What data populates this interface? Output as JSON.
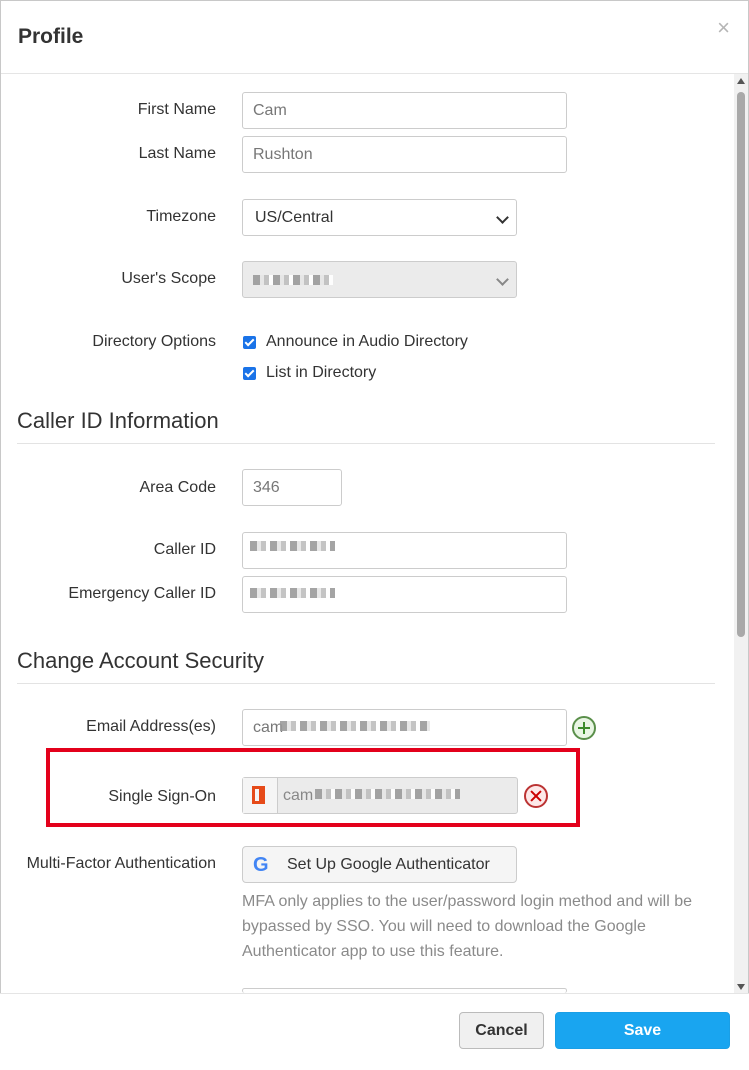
{
  "modal": {
    "title": "Profile",
    "close_label": "×"
  },
  "form": {
    "first_name": {
      "label": "First Name",
      "value": "Cam"
    },
    "last_name": {
      "label": "Last Name",
      "value": "Rushton"
    },
    "timezone": {
      "label": "Timezone",
      "value": "US/Central"
    },
    "scope": {
      "label": "User's Scope",
      "value": ""
    },
    "directory": {
      "label": "Directory Options",
      "options": [
        {
          "label": "Announce in Audio Directory",
          "checked": true
        },
        {
          "label": "List in Directory",
          "checked": true
        }
      ]
    }
  },
  "caller_id_section": {
    "title": "Caller ID Information",
    "area_code": {
      "label": "Area Code",
      "value": "346"
    },
    "caller_id": {
      "label": "Caller ID",
      "value": ""
    },
    "emergency_caller_id": {
      "label": "Emergency Caller ID",
      "value": ""
    }
  },
  "security_section": {
    "title": "Change Account Security",
    "email": {
      "label": "Email Address(es)",
      "value": "cam"
    },
    "sso": {
      "label": "Single Sign-On",
      "value": "cam",
      "provider_icon": "office-icon"
    },
    "mfa": {
      "label": "Multi-Factor Authentication",
      "button_label": "Set Up Google Authenticator",
      "help_text": "MFA only applies to the user/password login method and will be bypassed by SSO. You will need to download the Google Authenticator app to use this feature."
    }
  },
  "footer": {
    "cancel_label": "Cancel",
    "save_label": "Save"
  },
  "colors": {
    "highlight": "#e3001b",
    "save": "#19a5f0",
    "checkbox": "#1a73e8"
  }
}
